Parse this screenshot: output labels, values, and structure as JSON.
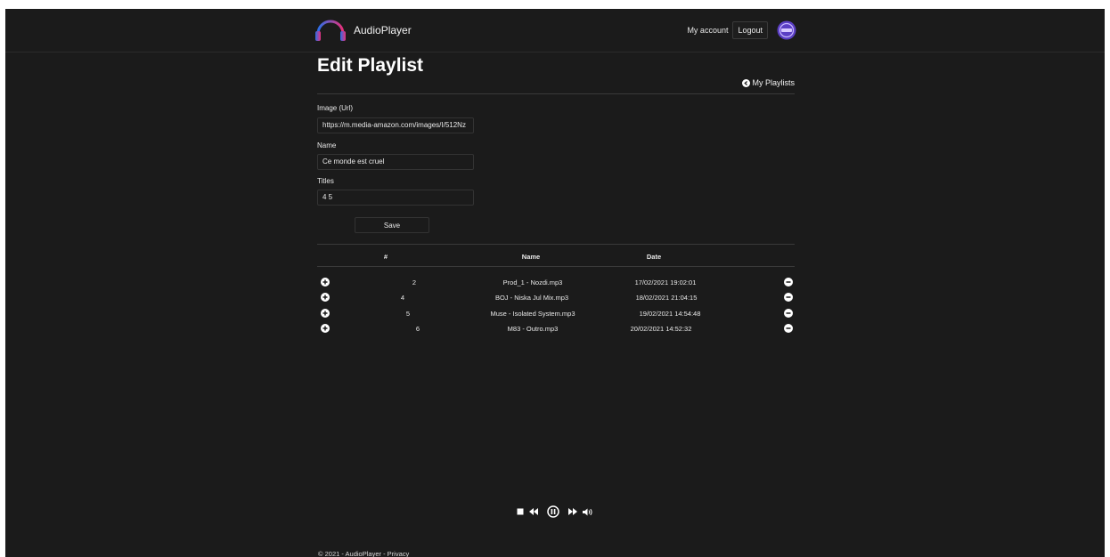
{
  "header": {
    "brand": "AudioPlayer",
    "my_account": "My account",
    "logout": "Logout"
  },
  "page": {
    "title": "Edit Playlist",
    "back_link": "My Playlists"
  },
  "form": {
    "image_label": "Image (Url)",
    "image_value": "https://m.media-amazon.com/images/I/512Nz",
    "name_label": "Name",
    "name_value": "Ce monde est cruel",
    "titles_label": "Titles",
    "titles_value": "4 5",
    "save_label": "Save"
  },
  "table": {
    "headers": [
      "#",
      "Name",
      "Date"
    ],
    "rows": [
      {
        "num": "2",
        "name": "Prod_1 - Nozdi.mp3",
        "date": "17/02/2021 19:02:01"
      },
      {
        "num": "4",
        "name": "BOJ - Niska Jul Mix.mp3",
        "date": "18/02/2021 21:04:15"
      },
      {
        "num": "5",
        "name": "Muse - Isolated System.mp3",
        "date": "19/02/2021 14:54:48"
      },
      {
        "num": "6",
        "name": "M83 - Outro.mp3",
        "date": "20/02/2021 14:52:32"
      }
    ]
  },
  "player": {
    "controls": [
      "stop-icon",
      "rewind-icon",
      "pause-icon",
      "fast-forward-icon",
      "volume-icon"
    ]
  },
  "footer": {
    "copyright": "© 2021 - AudioPlayer - ",
    "privacy": "Privacy"
  },
  "colors": {
    "background": "#1b1b1b",
    "text": "#ffffff",
    "logo_gradient_start": "#2b6fe8",
    "logo_gradient_end": "#e8307a",
    "avatar": "#5b3fc4"
  }
}
